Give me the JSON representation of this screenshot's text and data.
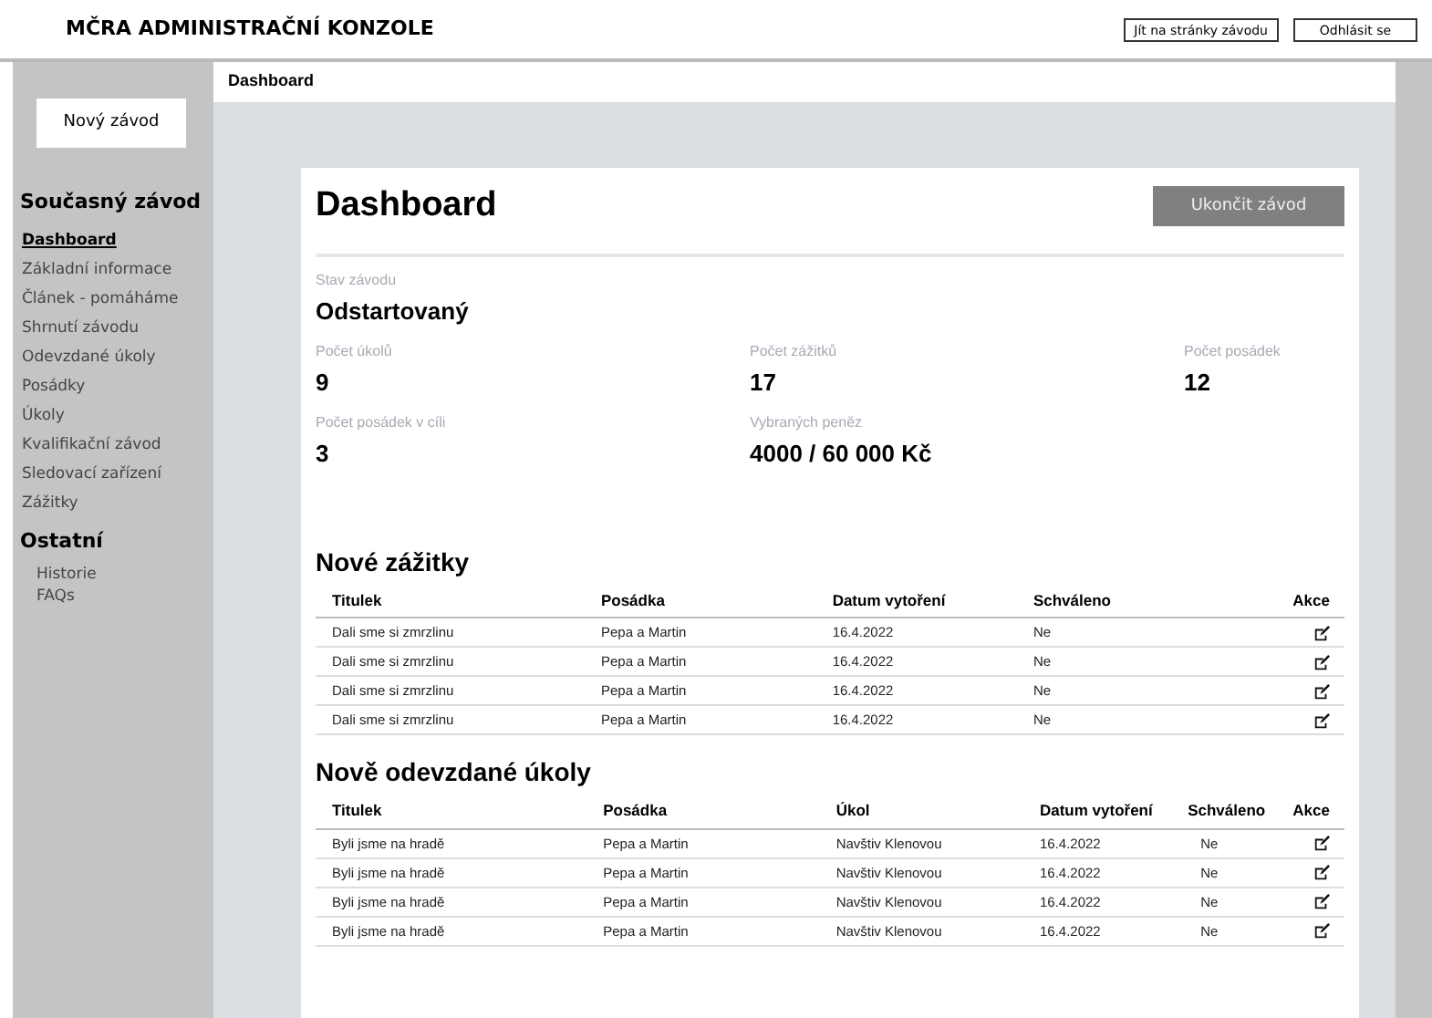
{
  "header": {
    "title": "MČRA ADMINISTRAČNÍ KONZOLE",
    "buttons": [
      "Jít na stránky závodu",
      "Odhlásit se"
    ]
  },
  "sidebar": {
    "new_button": "Nový závod",
    "sections": [
      {
        "title": "Současný závod",
        "items": [
          {
            "label": "Dashboard",
            "selected": true
          },
          {
            "label": "Základní informace",
            "selected": false
          },
          {
            "label": "Článek - pomáháme",
            "selected": false
          },
          {
            "label": "Shrnutí závodu",
            "selected": false
          },
          {
            "label": "Odevzdané úkoly",
            "selected": false
          },
          {
            "label": "Posádky",
            "selected": false
          },
          {
            "label": "Úkoly",
            "selected": false
          },
          {
            "label": "Kvalifikační závod",
            "selected": false
          },
          {
            "label": "Sledovací zařízení",
            "selected": false
          },
          {
            "label": "Zážitky",
            "selected": false
          }
        ]
      },
      {
        "title": "Ostatní",
        "items": [
          {
            "label": "Historie",
            "selected": false
          },
          {
            "label": "FAQs",
            "selected": false
          }
        ]
      }
    ]
  },
  "breadcrumb": "Dashboard",
  "page": {
    "title": "Dashboard",
    "end_button": "Ukončit závod",
    "status": {
      "label": "Stav závodu",
      "value": "Odstartovaný"
    },
    "stats": [
      {
        "label": "Počet úkolů",
        "value": "9"
      },
      {
        "label": "Počet zážitků",
        "value": "17"
      },
      {
        "label": "Počet posádek",
        "value": "12"
      },
      {
        "label": "Počet posádek v cíli",
        "value": "3"
      },
      {
        "label": "Vybraných peněz",
        "value": "4000 / 60 000 Kč"
      }
    ],
    "tables": [
      {
        "title": "Nové zážitky",
        "columns": [
          "Titulek",
          "Posádka",
          "Datum vytoření",
          "Schváleno",
          "Akce"
        ],
        "rows": [
          [
            "Dali sme si zmrzlinu",
            "Pepa a Martin",
            "16.4.2022",
            "Ne"
          ],
          [
            "Dali sme si zmrzlinu",
            "Pepa a Martin",
            "16.4.2022",
            "Ne"
          ],
          [
            "Dali sme si zmrzlinu",
            "Pepa a Martin",
            "16.4.2022",
            "Ne"
          ],
          [
            "Dali sme si zmrzlinu",
            "Pepa a Martin",
            "16.4.2022",
            "Ne"
          ]
        ]
      },
      {
        "title": "Nově odevzdané úkoly",
        "columns": [
          "Titulek",
          "Posádka",
          "Úkol",
          "Datum vytoření",
          "Schváleno",
          "Akce"
        ],
        "rows": [
          [
            "Byli jsme na hradě",
            "Pepa a Martin",
            "Navštiv Klenovou",
            "16.4.2022",
            "Ne"
          ],
          [
            "Byli jsme na hradě",
            "Pepa a Martin",
            "Navštiv Klenovou",
            "16.4.2022",
            "Ne"
          ],
          [
            "Byli jsme na hradě",
            "Pepa a Martin",
            "Navštiv Klenovou",
            "16.4.2022",
            "Ne"
          ],
          [
            "Byli jsme na hradě",
            "Pepa a Martin",
            "Navštiv Klenovou",
            "16.4.2022",
            "Ne"
          ]
        ]
      }
    ]
  }
}
